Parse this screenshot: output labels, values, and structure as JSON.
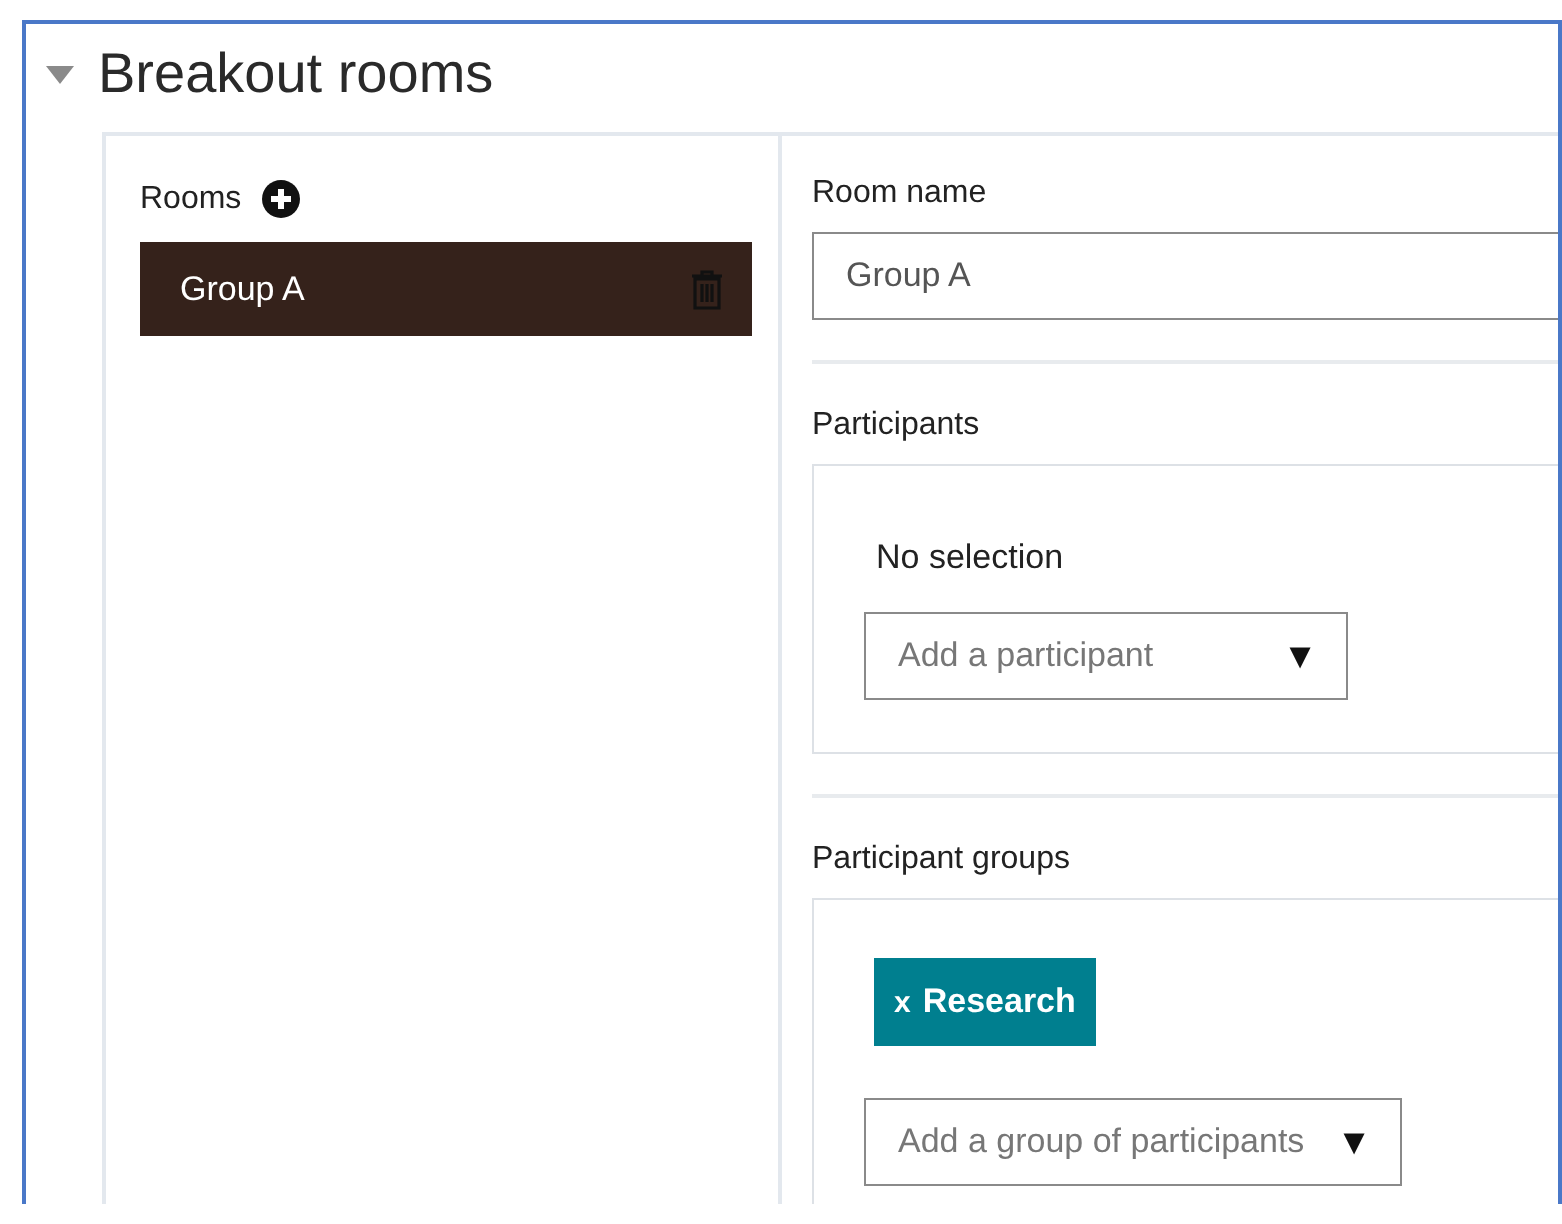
{
  "section": {
    "title": "Breakout rooms",
    "expanded": true
  },
  "rooms": {
    "label": "Rooms",
    "items": [
      {
        "name": "Group A",
        "selected": true
      }
    ]
  },
  "room_name": {
    "label": "Room name",
    "value": "Group A"
  },
  "participants": {
    "label": "Participants",
    "empty_text": "No selection",
    "dropdown": {
      "placeholder": "Add a participant",
      "arrow": "▼"
    }
  },
  "participant_groups": {
    "label": "Participant groups",
    "tags": [
      {
        "remove": "x",
        "label": "Research"
      }
    ],
    "dropdown": {
      "placeholder": "Add a group of participants",
      "arrow": "▼"
    }
  }
}
